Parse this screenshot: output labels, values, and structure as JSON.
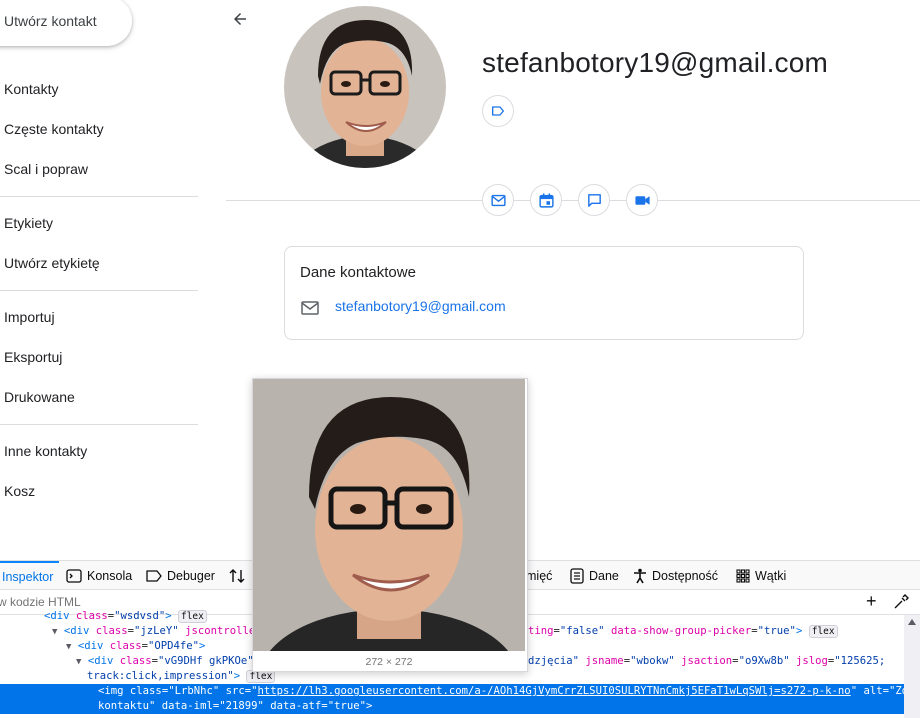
{
  "sidebar": {
    "create_contact": "Utwórz kontakt",
    "items": [
      {
        "label": "Kontakty"
      },
      {
        "label": "Częste kontakty"
      },
      {
        "label": "Scal i popraw"
      },
      {
        "label": "Etykiety"
      },
      {
        "label": "Utwórz etykietę"
      },
      {
        "label": "Importuj"
      },
      {
        "label": "Eksportuj"
      },
      {
        "label": "Drukowane"
      },
      {
        "label": "Inne kontakty"
      },
      {
        "label": "Kosz"
      }
    ]
  },
  "contact": {
    "name": "stefanbotory19@gmail.com",
    "icons": {
      "back": "arrow-left-icon",
      "label": "label-icon",
      "actions": [
        "email-icon",
        "calendar-event-icon",
        "chat-icon",
        "video-call-icon"
      ]
    }
  },
  "details_card": {
    "title": "Dane kontaktowe",
    "email": "stefanbotory19@gmail.com"
  },
  "devtools": {
    "tabs": [
      {
        "label": "Inspektor",
        "icon": "inspector-icon",
        "active": true
      },
      {
        "label": "Konsola",
        "icon": "console-icon"
      },
      {
        "label": "Debuger",
        "icon": "debugger-icon"
      },
      {
        "label": "",
        "icon": "network-icon"
      },
      {
        "label": "mięć",
        "icon": ""
      },
      {
        "label": "Dane",
        "icon": "storage-icon"
      },
      {
        "label": "Dostępność",
        "icon": "accessibility-icon"
      },
      {
        "label": "Wątki",
        "icon": "application-icon"
      }
    ],
    "search_placeholder": "w kodzie HTML",
    "code": {
      "line0_partial": "<div class=\"wsdvsd\">",
      "line1_tag": "div",
      "line1_attr": "class",
      "line1_val": "\"jzLeY\"",
      "line1_rest": "jscontroller",
      "line1_tail_attr": "ting",
      "line1_tail_val": "\"false\"",
      "line1_tail_attr2": "data-show-group-picker",
      "line1_tail_val2": "\"true\"",
      "line2_tag": "div",
      "line2_attr": "class",
      "line2_val": "\"OPD4fe\"",
      "line3_tag": "div",
      "line3_attr": "class",
      "line3_val": "\"vG9DHf gkPKOe\"",
      "line3_tail_val": "dzjęcia\"",
      "line3_tail_attr": "jsname",
      "line3_tail_val2": "\"wbokw\"",
      "line3_tail_attr2": "jsaction",
      "line3_tail_val3": "\"o9Xw8b\"",
      "line3_tail_attr3": "jslog",
      "line3_tail_val4": "\"125625;",
      "line4": "track:click,impression\"",
      "sel_tag": "img",
      "sel_attr1": "class",
      "sel_val1": "\"LrbNhc\"",
      "sel_attr2": "src",
      "sel_url": "https://lh3.googleusercontent.com/a-/AOh14GjVymCrrZLSUI0SULRYTNnCmkj5EFaT1wLqSWlj=s272-p-k-no",
      "sel_attr3": "alt",
      "sel_val3": "\"Zdjęcie",
      "sel_line2_val": "kontaktu\"",
      "sel_attr4": "data-iml",
      "sel_val4": "\"21899\"",
      "sel_attr5": "data-atf",
      "sel_val5": "\"true\""
    },
    "badge": "flex"
  },
  "image_preview": {
    "dimensions": "272 × 272"
  }
}
